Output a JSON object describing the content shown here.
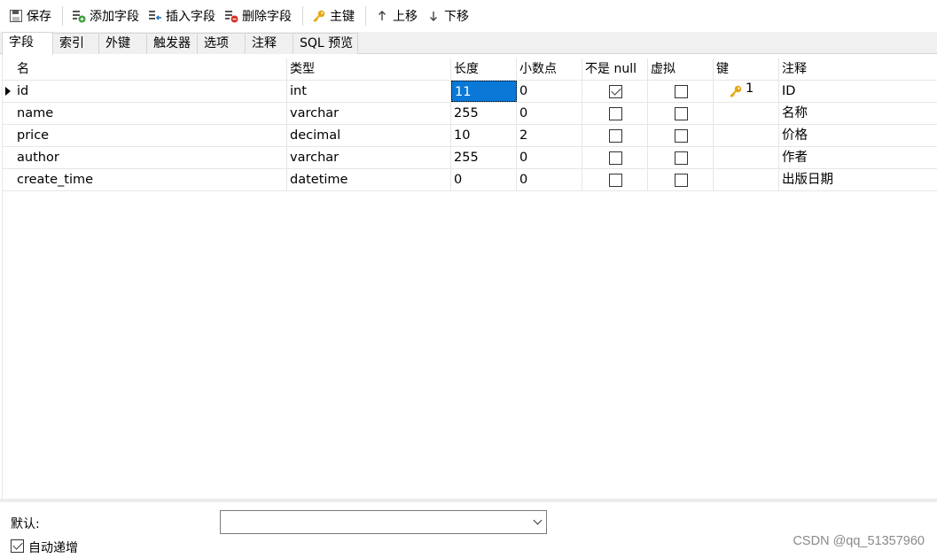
{
  "toolbar": {
    "save": "保存",
    "add_field": "添加字段",
    "insert_field": "插入字段",
    "delete_field": "删除字段",
    "primary_key": "主键",
    "move_up": "上移",
    "move_down": "下移"
  },
  "tabs": [
    "字段",
    "索引",
    "外键",
    "触发器",
    "选项",
    "注释",
    "SQL 预览"
  ],
  "columns": {
    "name": "名",
    "type": "类型",
    "length": "长度",
    "decimals": "小数点",
    "not_null": "不是 null",
    "virtual": "虚拟",
    "key": "键",
    "comment": "注释"
  },
  "rows": [
    {
      "name": "id",
      "type": "int",
      "length": "11",
      "decimals": "0",
      "not_null": true,
      "virtual": false,
      "key": "1",
      "comment": "ID"
    },
    {
      "name": "name",
      "type": "varchar",
      "length": "255",
      "decimals": "0",
      "not_null": false,
      "virtual": false,
      "key": "",
      "comment": "名称"
    },
    {
      "name": "price",
      "type": "decimal",
      "length": "10",
      "decimals": "2",
      "not_null": false,
      "virtual": false,
      "key": "",
      "comment": "价格"
    },
    {
      "name": "author",
      "type": "varchar",
      "length": "255",
      "decimals": "0",
      "not_null": false,
      "virtual": false,
      "key": "",
      "comment": "作者"
    },
    {
      "name": "create_time",
      "type": "datetime",
      "length": "0",
      "decimals": "0",
      "not_null": false,
      "virtual": false,
      "key": "",
      "comment": "出版日期"
    }
  ],
  "bottom": {
    "default_label": "默认:",
    "default_value": "",
    "auto_increment_label": "自动递增",
    "auto_increment": true
  },
  "watermark": "CSDN @qq_51357960",
  "colors": {
    "selection": "#0a78d7",
    "key_icon": "#e6a817"
  }
}
